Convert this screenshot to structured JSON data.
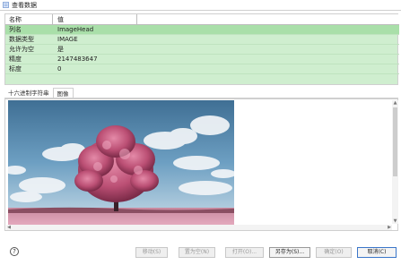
{
  "window": {
    "title": "查看数据"
  },
  "props": {
    "headers": [
      "名称",
      "值"
    ],
    "rows": [
      {
        "key": "列名",
        "value": "ImageHead"
      },
      {
        "key": "数据类型",
        "value": "IMAGE"
      },
      {
        "key": "允许为空",
        "value": "是"
      },
      {
        "key": "精度",
        "value": "2147483647"
      },
      {
        "key": "标度",
        "value": "0"
      }
    ]
  },
  "tabs": [
    {
      "label": "十六进制字符串"
    },
    {
      "label": "图像"
    }
  ],
  "buttons": {
    "btn1": "移动(S)",
    "btn2": "置为空(N)",
    "btn3": "打开(O)...",
    "btn4": "另存为(S)...",
    "btn5": "确定(O)",
    "btn6": "取消(C)"
  },
  "help": {
    "symbol": "?"
  },
  "colors": {
    "grid_bg": "#cfeecf",
    "tree_foliage": "#c05a7c",
    "sky": "#5f93b8"
  }
}
